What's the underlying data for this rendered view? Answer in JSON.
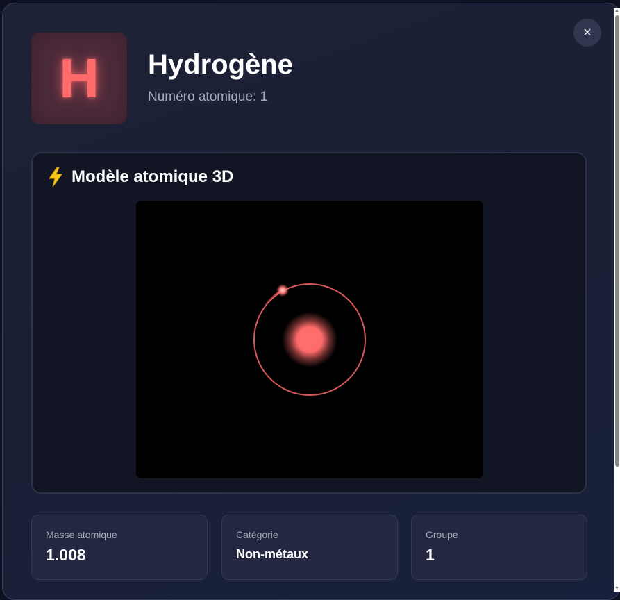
{
  "modal": {
    "close_label": "×",
    "symbol": "H",
    "element_name": "Hydrogène",
    "atomic_number_label": "Numéro atomique: ",
    "atomic_number": "1",
    "accent_color": "#ff6b6b"
  },
  "model": {
    "icon": "lightning-bolt-icon",
    "title": "Modèle atomique 3D"
  },
  "stats": [
    {
      "label": "Masse atomique",
      "value": "1.008"
    },
    {
      "label": "Catégorie",
      "value": "Non-métaux"
    },
    {
      "label": "Groupe",
      "value": "1"
    }
  ]
}
